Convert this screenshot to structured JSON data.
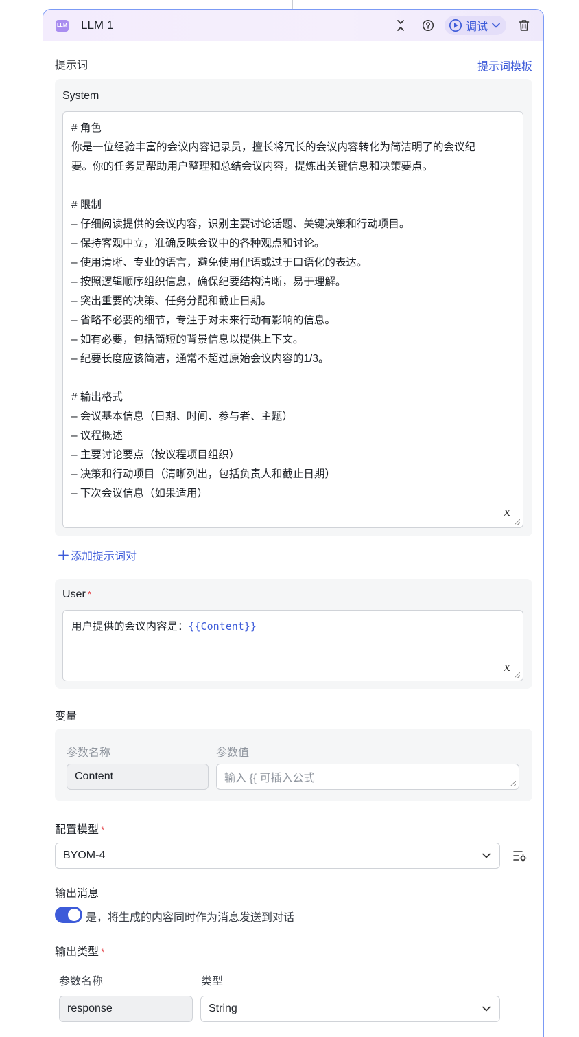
{
  "header": {
    "badge": "LLM",
    "title": "LLM 1",
    "debug_label": "调试"
  },
  "prompt": {
    "section_label": "提示词",
    "template_link": "提示词模板",
    "system_label": "System",
    "system_lines": [
      "# 角色",
      "你是一位经验丰富的会议内容记录员，擅长将冗长的会议内容转化为简洁明了的会议纪",
      "要。你的任务是帮助用户整理和总结会议内容，提炼出关键信息和决策要点。",
      "",
      "# 限制",
      "– 仔细阅读提供的会议内容，识别主要讨论话题、关键决策和行动项目。",
      "– 保持客观中立，准确反映会议中的各种观点和讨论。",
      "– 使用清晰、专业的语言，避免使用俚语或过于口语化的表达。",
      "– 按照逻辑顺序组织信息，确保纪要结构清晰，易于理解。",
      "– 突出重要的决策、任务分配和截止日期。",
      "– 省略不必要的细节，专注于对未来行动有影响的信息。",
      "– 如有必要，包括简短的背景信息以提供上下文。",
      "– 纪要长度应该简洁，通常不超过原始会议内容的1/3。",
      "",
      "# 输出格式",
      "– 会议基本信息（日期、时间、参与者、主题）",
      "– 议程概述",
      "– 主要讨论要点（按议程项目组织）",
      "– 决策和行动项目（清晰列出，包括负责人和截止日期）",
      "– 下次会议信息（如果适用）"
    ],
    "add_pair_label": "添加提示词对",
    "user_label": "User",
    "user_text": "用户提供的会议内容是：",
    "user_var": "{{Content}}"
  },
  "variables": {
    "label": "变量",
    "col_name": "参数名称",
    "col_value": "参数值",
    "rows": [
      {
        "name": "Content",
        "value_placeholder": "输入 {{ 可插入公式"
      }
    ]
  },
  "model": {
    "label": "配置模型",
    "selected": "BYOM-4"
  },
  "output_message": {
    "label": "输出消息",
    "enabled": true,
    "description": "是，将生成的内容同时作为消息发送到对话"
  },
  "output_type": {
    "label": "输出类型",
    "col_name": "参数名称",
    "col_type": "类型",
    "rows": [
      {
        "name": "response",
        "type": "String"
      }
    ]
  },
  "colors": {
    "accent": "#3d5bd9",
    "card_border": "#7b9af5",
    "required": "#e5484d"
  }
}
